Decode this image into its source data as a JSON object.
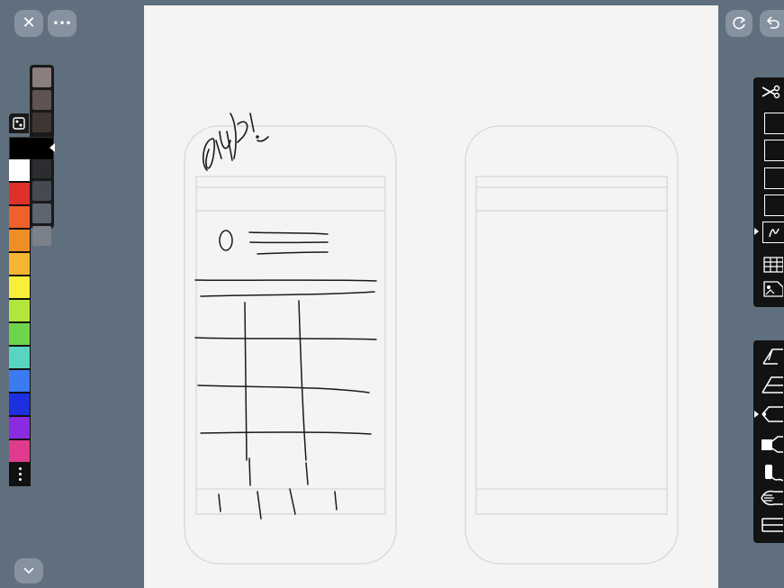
{
  "app": {
    "accent": "#5f6f7d",
    "canvas_color": "#f4f4f4"
  },
  "toolbar_left": {
    "close": {
      "icon": "close-icon",
      "glyph": "✕"
    },
    "more": {
      "icon": "more-icon",
      "glyph": "•••"
    },
    "collapse": {
      "icon": "chevron-down-icon",
      "glyph": "⌄"
    }
  },
  "toolbar_right": {
    "redo": {
      "icon": "redo-icon"
    },
    "undo": {
      "icon": "undo-icon"
    }
  },
  "palette": {
    "current_color": "#000000",
    "grays": [
      "#8a7f7d",
      "#5f5452",
      "#3f3634",
      "#2b2d31",
      "#454a52",
      "#5e6470",
      "#7b808b"
    ],
    "colors": [
      "#ffffff",
      "#e0302b",
      "#f0602a",
      "#f08e26",
      "#f5b533",
      "#f8ef3a",
      "#b3e63c",
      "#6ed44a",
      "#58d4c0",
      "#3b7bf2",
      "#1c30e0",
      "#8a2be0",
      "#e03c8e"
    ]
  },
  "templates": {
    "items": [
      {
        "name": "scissors-icon"
      },
      {
        "name": "frame-template-1"
      },
      {
        "name": "frame-template-2"
      },
      {
        "name": "frame-template-3"
      },
      {
        "name": "frame-template-4"
      },
      {
        "name": "pen-frame-icon",
        "selected": true
      },
      {
        "name": "grid-icon"
      },
      {
        "name": "image-template-icon"
      }
    ]
  },
  "brushes": {
    "items": [
      {
        "name": "fineliner-icon"
      },
      {
        "name": "pen-icon"
      },
      {
        "name": "pencil-icon",
        "selected": true
      },
      {
        "name": "marker-icon"
      },
      {
        "name": "brush-icon"
      },
      {
        "name": "watercolor-icon"
      },
      {
        "name": "eraser-icon"
      }
    ]
  }
}
